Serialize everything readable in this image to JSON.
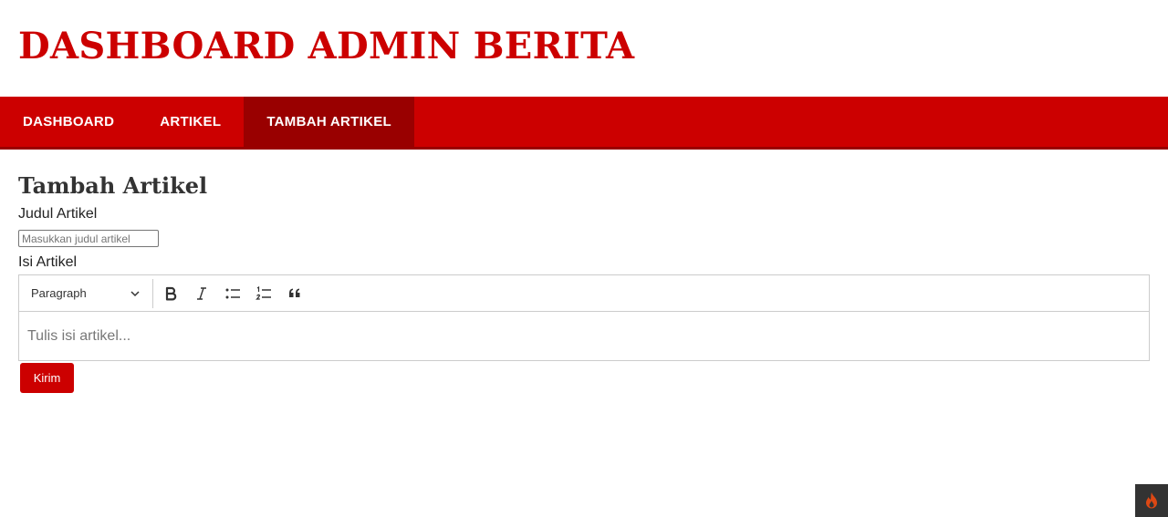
{
  "header": {
    "site_title": "DASHBOARD ADMIN BERITA"
  },
  "nav": {
    "items": [
      {
        "label": "DASHBOARD",
        "active": false
      },
      {
        "label": "ARTIKEL",
        "active": false
      },
      {
        "label": "TAMBAH ARTIKEL",
        "active": true
      }
    ]
  },
  "form": {
    "heading": "Tambah Artikel",
    "title_label": "Judul Artikel",
    "title_value": "",
    "title_placeholder": "Masukkan judul artikel",
    "body_label": "Isi Artikel",
    "editor": {
      "heading_select_value": "Paragraph",
      "toolbar_icons": [
        "bold-icon",
        "italic-icon",
        "bulleted-list-icon",
        "numbered-list-icon",
        "block-quote-icon"
      ],
      "placeholder": "Tulis isi artikel..."
    },
    "submit_label": "Kirim"
  },
  "debug_toolbar": {
    "icon": "flame-icon"
  },
  "colors": {
    "brand_red": "#cc0000",
    "active_nav": "#990000",
    "debug_bg": "#333333",
    "flame": "#dd4814"
  }
}
